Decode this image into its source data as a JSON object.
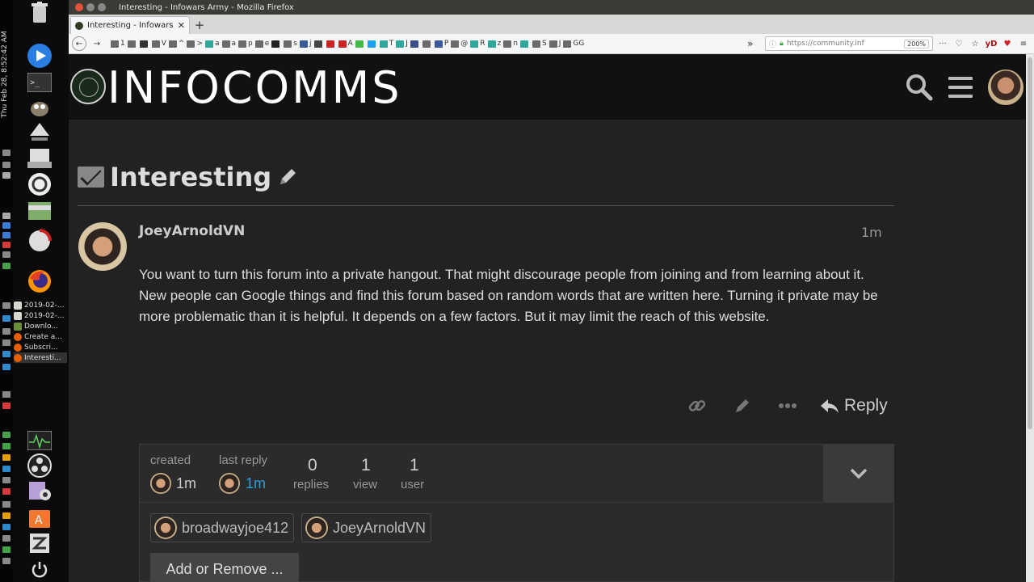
{
  "desktop": {
    "clock": "Thu Feb 28,  8:52:42 AM",
    "tasks": [
      {
        "label": "2019-02-...",
        "color": "#d8d8d0"
      },
      {
        "label": "2019-02-...",
        "color": "#d8d8d0"
      },
      {
        "label": "Downlo...",
        "color": "#6b8d3a"
      },
      {
        "label": "Create a...",
        "color": "#e66000"
      },
      {
        "label": "Subscri...",
        "color": "#e66000"
      },
      {
        "label": "Interesti...",
        "color": "#e66000"
      }
    ]
  },
  "browser": {
    "window_title": "Interesting - Infowars Army - Mozilla Firefox",
    "tab_title": "Interesting - Infowars A",
    "new_tab": "+",
    "url": "https://community.inf",
    "zoom": "200%",
    "bookmarks": [
      {
        "label": "1",
        "color": "#6a6a6a"
      },
      {
        "label": "",
        "color": "#6a6a6a"
      },
      {
        "label": "",
        "color": "#333333"
      },
      {
        "label": "V",
        "color": "#6a6a6a"
      },
      {
        "label": "^",
        "color": "#6a6a6a"
      },
      {
        "label": ">",
        "color": "#6a6a6a"
      },
      {
        "label": "a",
        "color": "#2ea89a"
      },
      {
        "label": "a",
        "color": "#6a6a6a"
      },
      {
        "label": "p",
        "color": "#6a6a6a"
      },
      {
        "label": "e",
        "color": "#6a6a6a"
      },
      {
        "label": "",
        "color": "#222222"
      },
      {
        "label": "s",
        "color": "#6a6a6a"
      },
      {
        "label": "j",
        "color": "#3b5998"
      },
      {
        "label": "",
        "color": "#444444"
      },
      {
        "label": "",
        "color": "#cc2222"
      },
      {
        "label": "A",
        "color": "#cc2222"
      },
      {
        "label": "",
        "color": "#45b649"
      },
      {
        "label": "",
        "color": "#1da1f2"
      },
      {
        "label": "T",
        "color": "#2ea89a"
      },
      {
        "label": "J",
        "color": "#2ea89a"
      },
      {
        "label": "",
        "color": "#3b4b8a"
      },
      {
        "label": "",
        "color": "#6a6a6a"
      },
      {
        "label": "P",
        "color": "#3b5998"
      },
      {
        "label": "@",
        "color": "#6a6a6a"
      },
      {
        "label": "R",
        "color": "#2ea89a"
      },
      {
        "label": "z",
        "color": "#2ea89a"
      },
      {
        "label": "n",
        "color": "#6a6a6a"
      },
      {
        "label": "",
        "color": "#2ea89a"
      },
      {
        "label": "S",
        "color": "#6a6a6a"
      },
      {
        "label": "J",
        "color": "#6a6a6a"
      },
      {
        "label": "GG",
        "color": "#6a6a6a"
      }
    ],
    "bookmark_overflow": "»",
    "toolbar_icons": [
      "···",
      "♡",
      "☆",
      "yD",
      "♥",
      "≡"
    ]
  },
  "site": {
    "logo_text": "INFOCOMMS"
  },
  "topic": {
    "title": "Interesting",
    "post": {
      "username": "JoeyArnoldVN",
      "date": "1m",
      "body": "You want to turn this forum into a private hangout. That might discourage people from joining and from learning about it. New people can Google things and find this forum based on random words that are written here. Turning it private may be more problematic than it is helpful. It depends on a few factors. But it may limit the reach of this website.",
      "reply_label": "Reply"
    },
    "map": {
      "created_label": "created",
      "created_value": "1m",
      "last_reply_label": "last reply",
      "last_reply_value": "1m",
      "replies_value": "0",
      "replies_label": "replies",
      "views_value": "1",
      "views_label": "view",
      "users_value": "1",
      "users_label": "user",
      "participants": [
        "broadwayjoe412",
        "JoeyArnoldVN"
      ],
      "add_remove_label": "Add or Remove ..."
    }
  },
  "colors": {
    "accent_link": "#2f9fd8",
    "page_bg": "#222222",
    "header_bg": "#111111"
  }
}
